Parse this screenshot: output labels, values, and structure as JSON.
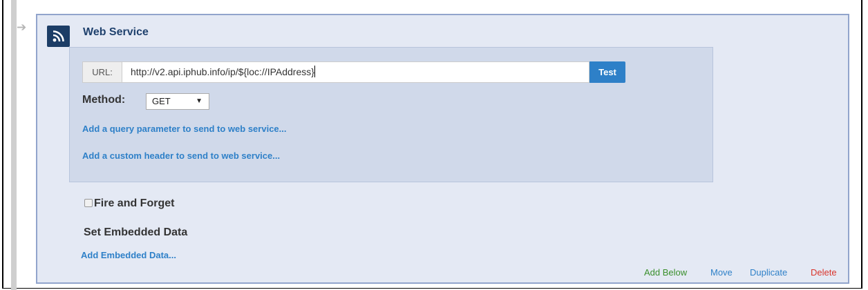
{
  "element": {
    "title": "Web Service",
    "icon": "rss-icon"
  },
  "url": {
    "label": "URL:",
    "value": "http://v2.api.iphub.info/ip/${loc://IPAddress}",
    "test_label": "Test"
  },
  "method": {
    "label": "Method:",
    "selected": "GET"
  },
  "links": {
    "add_query_param": "Add a query parameter to send to web service...",
    "add_custom_header": "Add a custom header to send to web service..."
  },
  "fire_and_forget": {
    "label": "Fire and Forget",
    "checked": false
  },
  "embedded_data": {
    "title": "Set Embedded Data",
    "add_label": "Add Embedded Data..."
  },
  "actions": {
    "add_below": "Add Below",
    "move": "Move",
    "duplicate": "Duplicate",
    "delete": "Delete"
  },
  "colors": {
    "link": "#2e80c8",
    "add_below": "#3a8f2c",
    "move": "#2e80c8",
    "duplicate": "#2e80c8",
    "delete": "#d9342b",
    "title": "#1f416d",
    "panel": "#d0d9ea",
    "box": "#e4e9f4"
  }
}
